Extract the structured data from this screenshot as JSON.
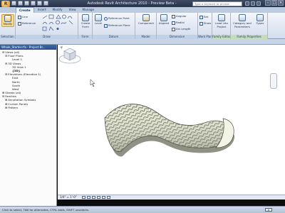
{
  "app": {
    "title": "Autodesk Revit Architecture 2010 - Preview Beta -",
    "app_button_letter": "R",
    "search_placeholder": "Type a keyword or phrase"
  },
  "ribbon": {
    "tabs": [
      "Create",
      "Insert",
      "Modify",
      "View",
      "Manage"
    ],
    "active_tab": "Create",
    "panels": {
      "selection": {
        "title": "Selection",
        "modify_label": "Modify"
      },
      "draw": {
        "title": "Draw",
        "line_label": "Line",
        "reference_label": "Reference"
      },
      "form": {
        "title": "Form",
        "create_form_label": "Create Form"
      },
      "datum": {
        "title": "Datum",
        "level_label": "Level",
        "reference_point_label": "Reference Point",
        "reference_plane_label": "Reference Plane"
      },
      "model": {
        "title": "Model",
        "component_label": "Component"
      },
      "dimension": {
        "title": "Dimension",
        "aligned_label": "Aligned",
        "angular_label": "Angular",
        "radial_label": "Radial",
        "arc_length_label": "Arc Length"
      },
      "work_plane": {
        "title": "Work Plane",
        "set_label": "Set",
        "show_label": "Show"
      },
      "family_editor": {
        "title": "Family Editor",
        "load_into_project_label": "Load into Project"
      },
      "family_properties": {
        "title": "Family Properties",
        "category_label": "Category and Parameters",
        "types_label": "Types"
      }
    }
  },
  "browser": {
    "title": "Whale_Starter.rfa - Project Br...",
    "items": [
      {
        "label": "Views (all)",
        "level": 0,
        "toggle": "⊟"
      },
      {
        "label": "Floor Plans",
        "level": 1,
        "toggle": "⊟"
      },
      {
        "label": "Level 1",
        "level": 2,
        "toggle": ""
      },
      {
        "label": "3D Views",
        "level": 1,
        "toggle": "⊟"
      },
      {
        "label": "3D View 1",
        "level": 2,
        "toggle": ""
      },
      {
        "label": "{3D}",
        "level": 2,
        "toggle": "",
        "selected": true
      },
      {
        "label": "Elevations (Elevation 1)",
        "level": 1,
        "toggle": "⊟"
      },
      {
        "label": "East",
        "level": 2,
        "toggle": ""
      },
      {
        "label": "North",
        "level": 2,
        "toggle": ""
      },
      {
        "label": "South",
        "level": 2,
        "toggle": ""
      },
      {
        "label": "West",
        "level": 2,
        "toggle": ""
      },
      {
        "label": "Sheets (all)",
        "level": 0,
        "toggle": "⊞"
      },
      {
        "label": "Families",
        "level": 0,
        "toggle": "⊟"
      },
      {
        "label": "Annotation Symbols",
        "level": 1,
        "toggle": "⊞"
      },
      {
        "label": "Curtain Panels",
        "level": 1,
        "toggle": "⊞"
      },
      {
        "label": "Pattern",
        "level": 1,
        "toggle": "⊞"
      }
    ]
  },
  "canvas": {
    "view_scale": "1/4\" = 1'-0\""
  },
  "statusbar": {
    "text": "Click to select, TAB for alternates, CTRL adds, SHIFT unselects.",
    "right_value": "0"
  }
}
